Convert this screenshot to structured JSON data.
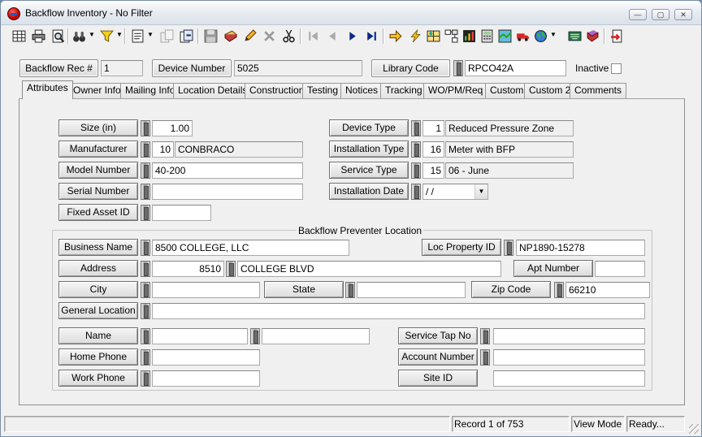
{
  "window": {
    "title": "Backflow Inventory - No Filter",
    "minimize": "—",
    "maximize": "▢",
    "close": "✕"
  },
  "header": {
    "rec_label": "Backflow Rec #",
    "rec_value": "1",
    "device_label": "Device Number",
    "device_value": "5025",
    "library_label": "Library Code",
    "library_value": "RPCO42A",
    "inactive_label": "Inactive"
  },
  "tabs": [
    "Attributes",
    "Owner Info",
    "Mailing Info",
    "Location Details",
    "Construction",
    "Testing",
    "Notices",
    "Tracking",
    "WO/PM/Req",
    "Custom",
    "Custom 2",
    "Comments"
  ],
  "attributes": {
    "size_label": "Size (in)",
    "size_value": "1.00",
    "manufacturer_label": "Manufacturer",
    "manufacturer_code": "10",
    "manufacturer_name": "CONBRACO",
    "model_label": "Model Number",
    "model_value": "40-200",
    "serial_label": "Serial Number",
    "serial_value": "",
    "asset_label": "Fixed Asset ID",
    "asset_value": "",
    "device_type_label": "Device Type",
    "device_type_code": "1",
    "device_type_name": "Reduced Pressure Zone",
    "install_type_label": "Installation Type",
    "install_type_code": "16",
    "install_type_name": "Meter with BFP",
    "service_type_label": "Service Type",
    "service_type_code": "15",
    "service_type_name": "06 - June",
    "install_date_label": "Installation Date",
    "install_date_value": " /  /"
  },
  "location": {
    "title": "Backflow Preventer Location",
    "business_label": "Business Name",
    "business_value": "8500 COLLEGE, LLC",
    "loc_prop_label": "Loc Property ID",
    "loc_prop_value": "NP1890-15278",
    "address_label": "Address",
    "address_number": "8510",
    "address_street": "COLLEGE BLVD",
    "apt_label": "Apt Number",
    "apt_value": "",
    "city_label": "City",
    "city_value": "",
    "state_label": "State",
    "state_value": "",
    "zip_label": "Zip Code",
    "zip_value": "66210",
    "general_label": "General Location",
    "general_value": "",
    "name_label": "Name",
    "name_first": "",
    "name_last": "",
    "tap_label": "Service Tap No",
    "tap_value": "",
    "home_label": "Home Phone",
    "home_value": "",
    "account_label": "Account Number",
    "account_value": "",
    "work_label": "Work Phone",
    "work_value": "",
    "site_label": "Site ID",
    "site_value": ""
  },
  "status": {
    "record": "Record 1 of 753",
    "mode": "View Mode",
    "state": "Ready..."
  },
  "toolbar_icons": [
    "grid-icon",
    "print-icon",
    "print-preview-icon",
    "binoculars-icon",
    "filter-icon",
    "report-icon",
    "copy-record-icon",
    "export-icon",
    "save-icon",
    "notebook-icon",
    "edit-pencil-icon",
    "delete-icon",
    "cut-icon",
    "first-record-icon",
    "previous-record-icon",
    "next-record-icon",
    "last-record-icon",
    "goto-arrow-icon",
    "lightning-icon",
    "map-icon",
    "network-icon",
    "chart-icon",
    "calculator-icon",
    "gis-icon",
    "truck-icon",
    "globe-icon",
    "keyboard-icon",
    "help-book-icon",
    "exit-icon"
  ]
}
